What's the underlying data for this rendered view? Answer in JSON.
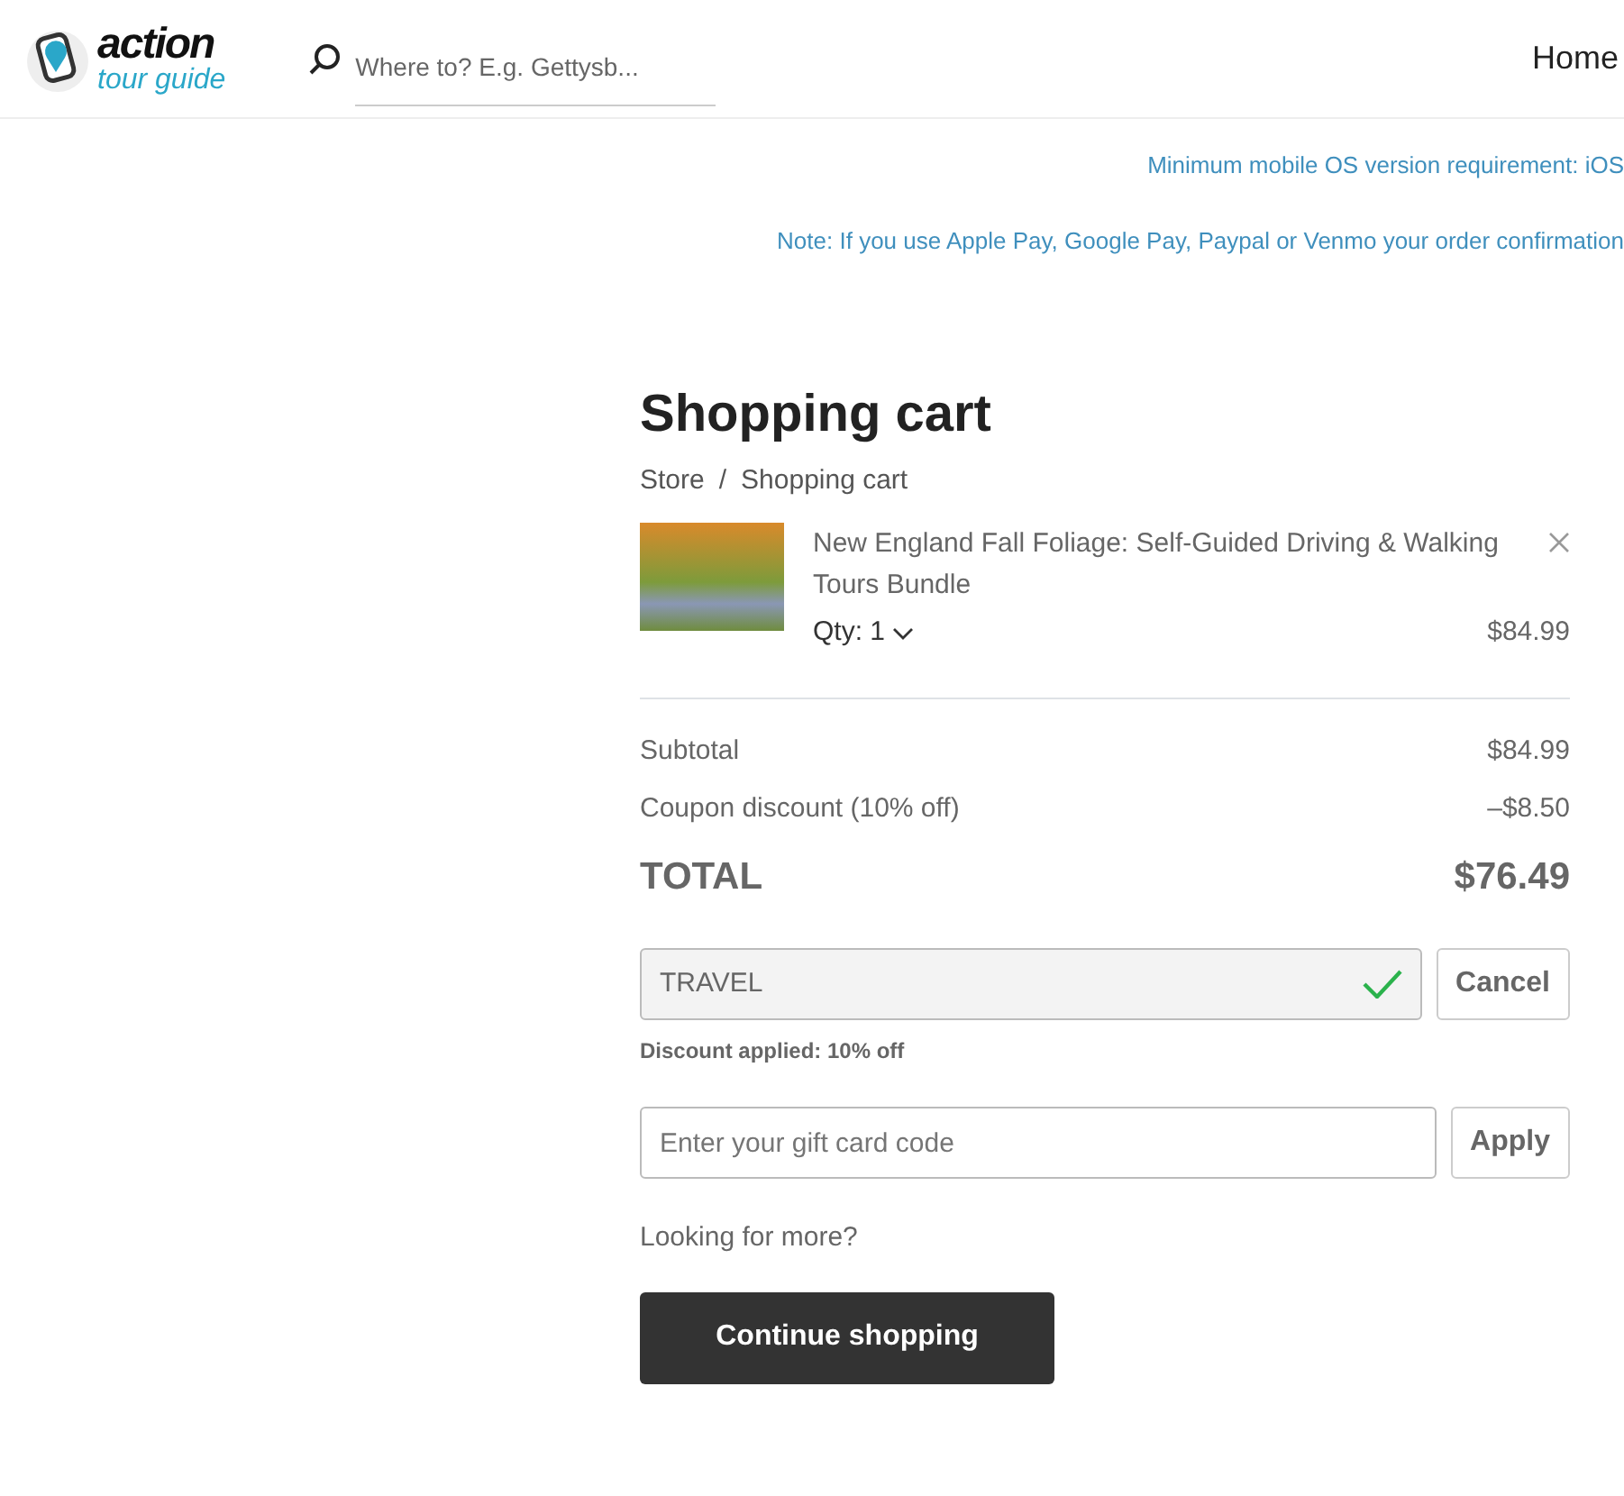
{
  "header": {
    "logo": {
      "top": "action",
      "bottom": "tour guide"
    },
    "search": {
      "placeholder": "Where to? E.g. Gettysb..."
    },
    "nav": [
      "Home"
    ]
  },
  "notices": [
    "Minimum mobile OS version requirement: iOS",
    "Note: If you use Apple Pay, Google Pay, Paypal or Venmo your order confirmation"
  ],
  "title": "Shopping cart",
  "breadcrumb": [
    "Store",
    "/",
    "Shopping cart"
  ],
  "items": [
    {
      "name": "New England Fall Foliage: Self-Guided Driving & Walking Tours Bundle",
      "quantity": "Qty: 1",
      "price": "$84.99"
    }
  ],
  "summary": [
    {
      "kind": "line",
      "label": "Subtotal",
      "value": "$84.99"
    },
    {
      "kind": "line",
      "label": "Coupon discount (10% off)",
      "value": "–$8.50"
    },
    {
      "kind": "total",
      "label": "TOTAL",
      "value": "$76.49"
    }
  ],
  "coupon": {
    "value": "TRAVEL",
    "valid": true,
    "button": "Cancel",
    "message": "Discount applied: 10% off"
  },
  "gift_card": {
    "placeholder": "Enter your gift card code",
    "button": "Apply"
  },
  "more_text": "Looking for more?",
  "continue_button": "Continue shopping"
}
